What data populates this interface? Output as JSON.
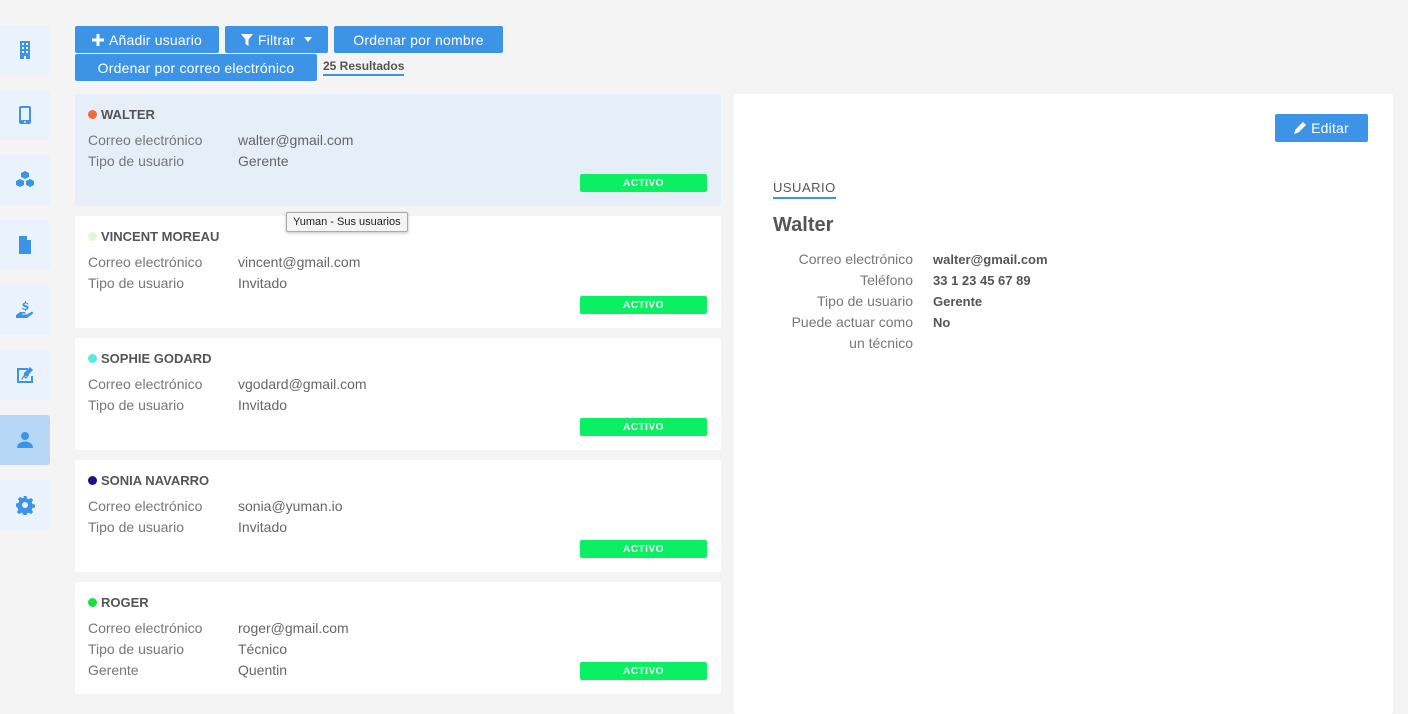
{
  "sidebar": {
    "items": [
      {
        "icon": "building-icon",
        "active": false
      },
      {
        "icon": "mobile-icon",
        "active": false
      },
      {
        "icon": "cubes-icon",
        "active": false
      },
      {
        "icon": "document-icon",
        "active": false
      },
      {
        "icon": "hand-dollar-icon",
        "active": false
      },
      {
        "icon": "chart-edit-icon",
        "active": false
      },
      {
        "icon": "user-icon",
        "active": true
      },
      {
        "icon": "gear-icon",
        "active": false
      }
    ]
  },
  "toolbar": {
    "add_user": "Añadir usuario",
    "filter": "Filtrar",
    "sort_name": "Ordenar por nombre",
    "sort_email": "Ordenar por correo electrónico",
    "results": "25 Resultados"
  },
  "tooltip": "Yuman - Sus usuarios",
  "users": [
    {
      "name": "WALTER",
      "dot_color": "#f46a3a",
      "selected": true,
      "fields": [
        {
          "label": "Correo electrónico",
          "value": "walter@gmail.com"
        },
        {
          "label": "Tipo de usuario",
          "value": "Gerente"
        }
      ],
      "status": "ACTIVO"
    },
    {
      "name": "VINCENT MOREAU",
      "dot_color": "#e4f5d2",
      "selected": false,
      "fields": [
        {
          "label": "Correo electrónico",
          "value": "vincent@gmail.com"
        },
        {
          "label": "Tipo de usuario",
          "value": "Invitado"
        }
      ],
      "status": "ACTIVO"
    },
    {
      "name": "SOPHIE GODARD",
      "dot_color": "#5ce8e0",
      "selected": false,
      "fields": [
        {
          "label": "Correo electrónico",
          "value": "vgodard@gmail.com"
        },
        {
          "label": "Tipo de usuario",
          "value": "Invitado"
        }
      ],
      "status": "ACTIVO"
    },
    {
      "name": "SONIA NAVARRO",
      "dot_color": "#1f0f8c",
      "selected": false,
      "fields": [
        {
          "label": "Correo electrónico",
          "value": "sonia@yuman.io"
        },
        {
          "label": "Tipo de usuario",
          "value": "Invitado"
        }
      ],
      "status": "ACTIVO"
    },
    {
      "name": "ROGER",
      "dot_color": "#17e33a",
      "selected": false,
      "fields": [
        {
          "label": "Correo electrónico",
          "value": "roger@gmail.com"
        },
        {
          "label": "Tipo de usuario",
          "value": "Técnico"
        },
        {
          "label": "Gerente",
          "value": "Quentin"
        }
      ],
      "status": "ACTIVO"
    }
  ],
  "detail": {
    "edit": "Editar",
    "section": "USUARIO",
    "name": "Walter",
    "fields": [
      {
        "label": "Correo electrónico",
        "value": "walter@gmail.com"
      },
      {
        "label": "Teléfono",
        "value": "33 1 23 45 67 89"
      },
      {
        "label": "Tipo de usuario",
        "value": "Gerente"
      },
      {
        "label": "Puede actuar como un técnico",
        "value": "No"
      }
    ]
  },
  "colors": {
    "accent": "#3d94e6",
    "status_active": "#0bef62"
  }
}
